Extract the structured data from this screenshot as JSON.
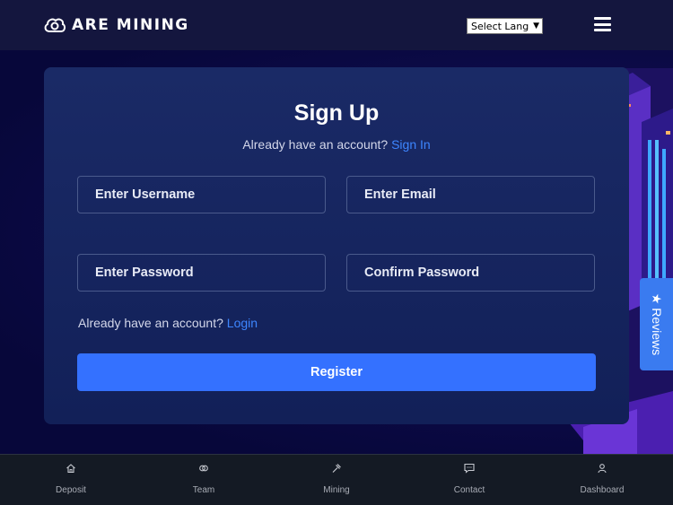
{
  "brand": {
    "name": "ARE MINING",
    "logo_icon": "cloud-logo-icon"
  },
  "header": {
    "language_select": "Select Lang",
    "menu_icon": "hamburger-icon"
  },
  "form": {
    "title": "Sign Up",
    "subtitle_text": "Already have an account?",
    "subtitle_link": "Sign In",
    "fields": {
      "username": "Enter Username",
      "email": "Enter Email",
      "password": "Enter Password",
      "confirm_password": "Confirm Password"
    },
    "login_text": "Already have an account?",
    "login_link": "Login",
    "register_label": "Register"
  },
  "reviews_tab": "★ Reviews",
  "bottom_nav": [
    {
      "label": "Deposit",
      "icon": "home-icon"
    },
    {
      "label": "Team",
      "icon": "team-icon"
    },
    {
      "label": "Mining",
      "icon": "hammer-icon"
    },
    {
      "label": "Contact",
      "icon": "chat-icon"
    },
    {
      "label": "Dashboard",
      "icon": "user-icon"
    }
  ],
  "colors": {
    "accent": "#3471ff",
    "link": "#3d86ff",
    "card": "#1a2a66",
    "nav": "#141a24"
  }
}
